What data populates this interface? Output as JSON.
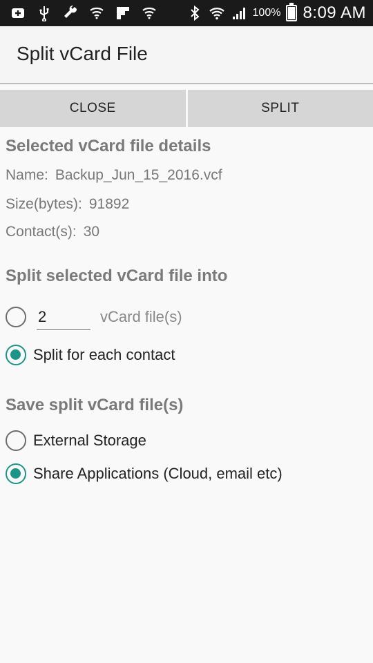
{
  "status_bar": {
    "icons": [
      "add-box-icon",
      "usb-icon",
      "wrench-icon",
      "signal-app-icon",
      "flipboard-icon",
      "signal-app-icon-2",
      "bluetooth-icon",
      "wifi-icon",
      "cell-signal-icon"
    ],
    "battery": "100%",
    "battery_level": 1.0,
    "time": "8:09 AM"
  },
  "app_bar": {
    "title": "Split vCard File"
  },
  "actions": {
    "close_label": "CLOSE",
    "split_label": "SPLIT"
  },
  "details": {
    "heading": "Selected vCard file details",
    "name_label": "Name:",
    "name_value": "Backup_Jun_15_2016.vcf",
    "size_label": "Size(bytes):",
    "size_value": "91892",
    "contacts_label": "Contact(s):",
    "contacts_value": "30"
  },
  "split_options": {
    "heading": "Split selected vCard file into",
    "count_value": "2",
    "count_suffix": "vCard file(s)",
    "count_selected": false,
    "each_contact_label": "Split for each contact",
    "each_contact_selected": true
  },
  "save_options": {
    "heading": "Save split vCard file(s)",
    "external_label": "External Storage",
    "external_selected": false,
    "share_label": "Share Applications (Cloud, email etc)",
    "share_selected": true
  },
  "colors": {
    "accent": "#1d9488",
    "status_bar": "#1a1a1a"
  }
}
